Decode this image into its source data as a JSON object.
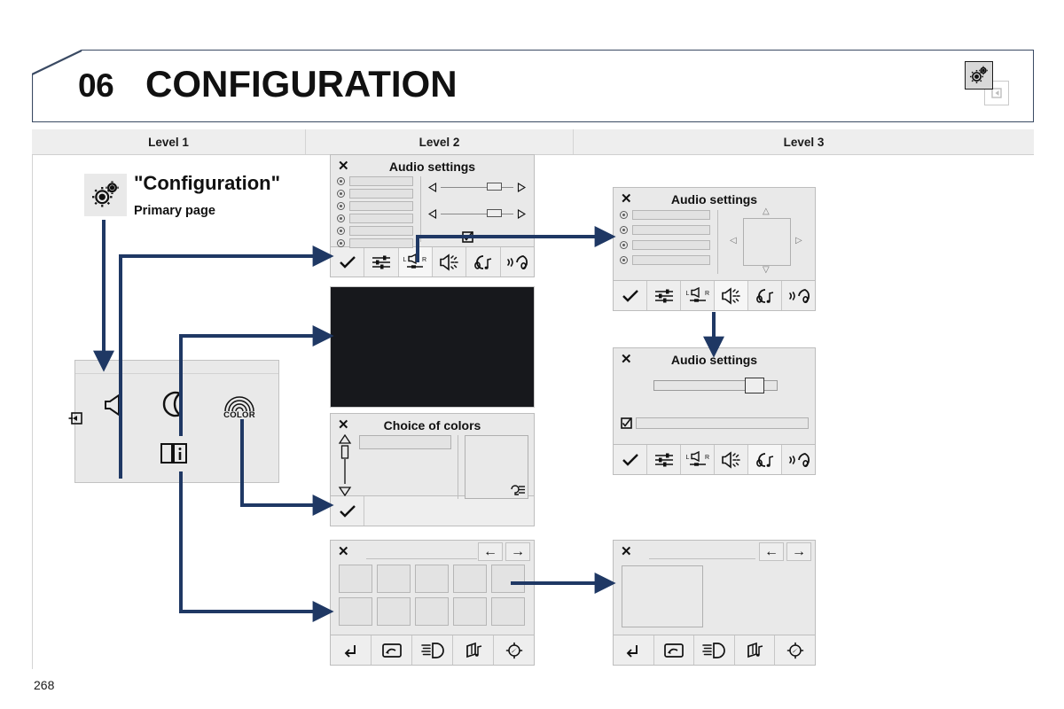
{
  "document": {
    "chapter_number": "06",
    "chapter_title": "CONFIGURATION",
    "page_number": "268"
  },
  "header": {
    "corner_icon": "gear-config-icon",
    "corner_secondary_icon": "exit-arrow-icon"
  },
  "columns": [
    {
      "label": "Level 1"
    },
    {
      "label": "Level 2"
    },
    {
      "label": "Level 3"
    }
  ],
  "level1": {
    "entry_title": "\"Configuration\"",
    "entry_subtitle": "Primary page",
    "entry_icon": "gear-config-icon",
    "panel": {
      "exit_icon": "exit-arrow-icon",
      "items": [
        {
          "name": "audio-settings",
          "icon": "speaker-icon"
        },
        {
          "name": "night-mode",
          "icon": "moon-icon"
        },
        {
          "name": "choice-of-colors",
          "icon": "color-rainbow-icon",
          "label": "COLOR"
        },
        {
          "name": "vehicle-manual",
          "icon": "book-info-icon"
        }
      ]
    }
  },
  "screens": {
    "audio_l2": {
      "title": "Audio settings",
      "close_label": "✕",
      "rows": 6,
      "sliders": [
        {
          "name": "slider-1",
          "value": 72
        },
        {
          "name": "slider-2",
          "value": 72
        }
      ],
      "checkbox": {
        "name": "option-checkbox",
        "checked": true
      },
      "tabs": [
        {
          "name": "confirm-tab",
          "icon": "check-icon",
          "selected": false
        },
        {
          "name": "equalizer-tab",
          "icon": "equalizer-icon",
          "selected": false
        },
        {
          "name": "balance-tab",
          "icon": "balance-lr-icon",
          "selected": true
        },
        {
          "name": "loudness-tab",
          "icon": "speaker-waves-icon",
          "selected": false
        },
        {
          "name": "ambience-tab",
          "icon": "headphone-note-icon",
          "selected": false
        },
        {
          "name": "voice-tab",
          "icon": "voice-headset-icon",
          "selected": false
        }
      ]
    },
    "night_mode": {
      "name": "night-mode-screen",
      "content": ""
    },
    "colors_l2": {
      "title": "Choice of colors",
      "close_label": "✕",
      "list_item": "",
      "preview_icon": "color-sample-icon",
      "tabs": [
        {
          "name": "confirm-tab",
          "icon": "check-icon",
          "selected": false
        }
      ]
    },
    "tiles_l2": {
      "close_label": "✕",
      "prev_label": "←",
      "next_label": "→",
      "tile_count": 10,
      "tabs": [
        {
          "name": "return-tab",
          "icon": "return-arrow-icon"
        },
        {
          "name": "mirror-tab",
          "icon": "rear-mirror-icon"
        },
        {
          "name": "lighting-tab",
          "icon": "headlight-beam-icon"
        },
        {
          "name": "wiper-tab",
          "icon": "wiper-washer-icon"
        },
        {
          "name": "target-tab",
          "icon": "target-compass-icon"
        }
      ]
    },
    "audio_l3_balance": {
      "title": "Audio settings",
      "close_label": "✕",
      "rows": 4,
      "pad": {
        "name": "balance-fader-pad",
        "up": "△",
        "down": "▽",
        "left": "◁",
        "right": "▷"
      },
      "tabs": [
        {
          "name": "confirm-tab",
          "icon": "check-icon",
          "selected": false
        },
        {
          "name": "equalizer-tab",
          "icon": "equalizer-icon",
          "selected": false
        },
        {
          "name": "balance-tab",
          "icon": "balance-lr-icon",
          "selected": false
        },
        {
          "name": "loudness-tab",
          "icon": "speaker-waves-icon",
          "selected": true
        },
        {
          "name": "ambience-tab",
          "icon": "headphone-note-icon",
          "selected": false
        },
        {
          "name": "voice-tab",
          "icon": "voice-headset-icon",
          "selected": false
        }
      ]
    },
    "audio_l3_volume": {
      "title": "Audio settings",
      "close_label": "✕",
      "slider": {
        "name": "volume-slider",
        "value": 78
      },
      "checkbox": {
        "name": "option-checkbox",
        "checked": true
      },
      "tabs": [
        {
          "name": "confirm-tab",
          "icon": "check-icon",
          "selected": false
        },
        {
          "name": "equalizer-tab",
          "icon": "equalizer-icon",
          "selected": false
        },
        {
          "name": "balance-tab",
          "icon": "balance-lr-icon",
          "selected": false
        },
        {
          "name": "loudness-tab",
          "icon": "speaker-waves-icon",
          "selected": false
        },
        {
          "name": "ambience-tab",
          "icon": "headphone-note-icon",
          "selected": true
        },
        {
          "name": "voice-tab",
          "icon": "voice-headset-icon",
          "selected": false
        }
      ]
    },
    "tiles_l3": {
      "close_label": "✕",
      "prev_label": "←",
      "next_label": "→",
      "tabs": [
        {
          "name": "return-tab",
          "icon": "return-arrow-icon"
        },
        {
          "name": "mirror-tab",
          "icon": "rear-mirror-icon"
        },
        {
          "name": "lighting-tab",
          "icon": "headlight-beam-icon"
        },
        {
          "name": "wiper-tab",
          "icon": "wiper-washer-icon"
        },
        {
          "name": "target-tab",
          "icon": "target-compass-icon"
        }
      ]
    }
  },
  "colors": {
    "arrow": "#1f3864",
    "frame": "#3a4a63",
    "screen_bg": "#e9e9e9",
    "header_row_bg": "#eeeeee",
    "night_screen": "#17181c",
    "text": "#111111"
  }
}
